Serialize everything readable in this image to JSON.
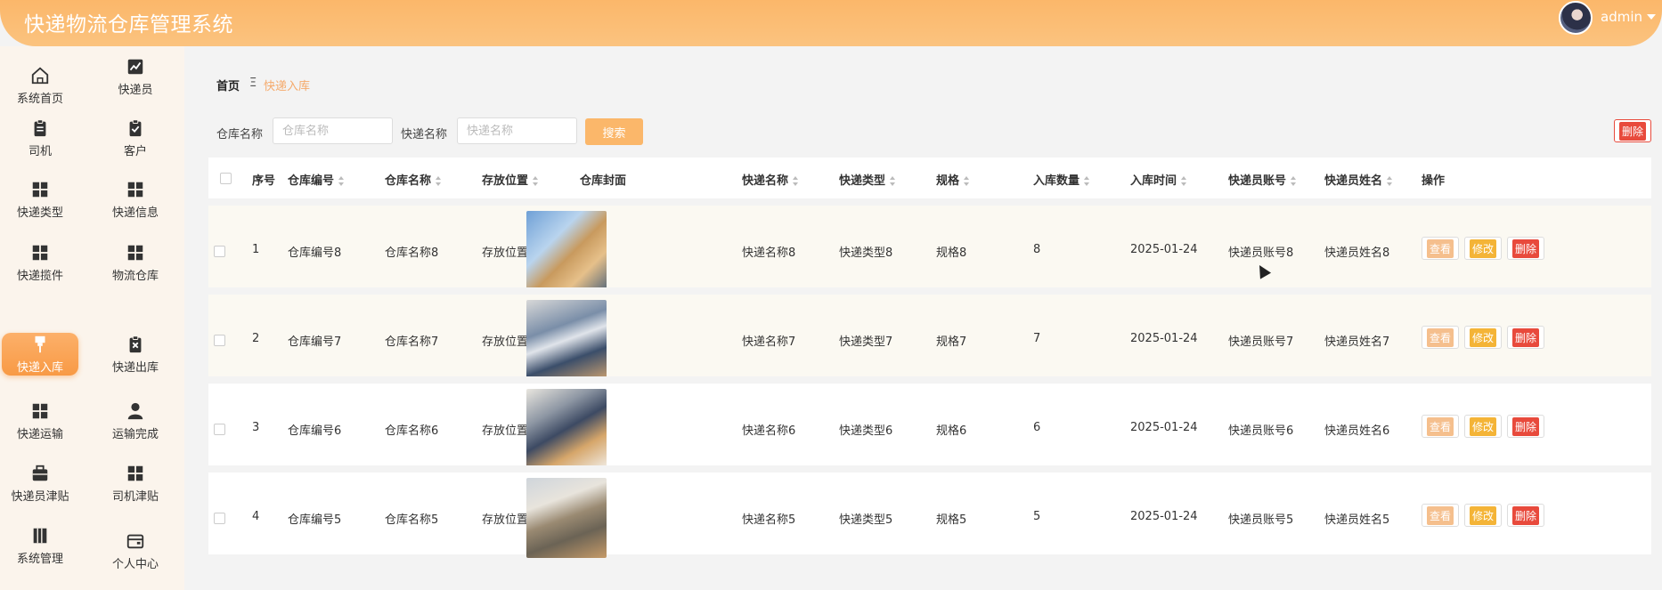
{
  "header": {
    "title": "快递物流仓库管理系统",
    "user": "admin"
  },
  "sidebar": {
    "items": [
      {
        "label": "系统首页",
        "icon": "home-icon"
      },
      {
        "label": "快递员",
        "icon": "chart-icon"
      },
      {
        "label": "司机",
        "icon": "clipboard-icon"
      },
      {
        "label": "客户",
        "icon": "clipboard-check-icon"
      },
      {
        "label": "快递类型",
        "icon": "grid-icon"
      },
      {
        "label": "快递信息",
        "icon": "grid-icon"
      },
      {
        "label": "快递揽件",
        "icon": "grid-icon"
      },
      {
        "label": "物流仓库",
        "icon": "grid-icon"
      },
      {
        "label": "快递入库",
        "icon": "brush-icon"
      },
      {
        "label": "快递出库",
        "icon": "clipboard-x-icon"
      },
      {
        "label": "快递运输",
        "icon": "grid-icon"
      },
      {
        "label": "运输完成",
        "icon": "person-icon"
      },
      {
        "label": "快递员津贴",
        "icon": "briefcase-icon"
      },
      {
        "label": "司机津贴",
        "icon": "grid-icon"
      },
      {
        "label": "系统管理",
        "icon": "book-icon"
      },
      {
        "label": "个人中心",
        "icon": "wallet-icon"
      }
    ]
  },
  "breadcrumb": {
    "home": "首页",
    "sep": "Ξ",
    "current": "快递入库"
  },
  "filters": {
    "warehouse_label": "仓库名称",
    "warehouse_placeholder": "仓库名称",
    "express_label": "快递名称",
    "express_placeholder": "快递名称",
    "search_label": "搜索"
  },
  "delete_all_label": "删除",
  "table": {
    "headers": [
      "序号",
      "仓库编号",
      "仓库名称",
      "存放位置",
      "仓库封面",
      "快递名称",
      "快递类型",
      "规格",
      "入库数量",
      "入库时间",
      "快递员账号",
      "快递员姓名",
      "操作"
    ],
    "actions": {
      "view": "查看",
      "edit": "修改",
      "delete": "删除"
    },
    "rows": [
      {
        "index": "1",
        "code": "仓库编号8",
        "name": "仓库名称8",
        "location": "存放位置8",
        "express": "快递名称8",
        "type": "快递类型8",
        "spec": "规格8",
        "qty": "8",
        "date": "2025-01-24",
        "account": "快递员账号8",
        "courier": "快递员姓名8"
      },
      {
        "index": "2",
        "code": "仓库编号7",
        "name": "仓库名称7",
        "location": "存放位置7",
        "express": "快递名称7",
        "type": "快递类型7",
        "spec": "规格7",
        "qty": "7",
        "date": "2025-01-24",
        "account": "快递员账号7",
        "courier": "快递员姓名7"
      },
      {
        "index": "3",
        "code": "仓库编号6",
        "name": "仓库名称6",
        "location": "存放位置6",
        "express": "快递名称6",
        "type": "快递类型6",
        "spec": "规格6",
        "qty": "6",
        "date": "2025-01-24",
        "account": "快递员账号6",
        "courier": "快递员姓名6"
      },
      {
        "index": "4",
        "code": "仓库编号5",
        "name": "仓库名称5",
        "location": "存放位置5",
        "express": "快递名称5",
        "type": "快递类型5",
        "spec": "规格5",
        "qty": "5",
        "date": "2025-01-24",
        "account": "快递员账号5",
        "courier": "快递员姓名5"
      }
    ]
  },
  "colors": {
    "accent": "#fbb76a",
    "danger": "#e84a3c",
    "warning": "#f4b437"
  }
}
